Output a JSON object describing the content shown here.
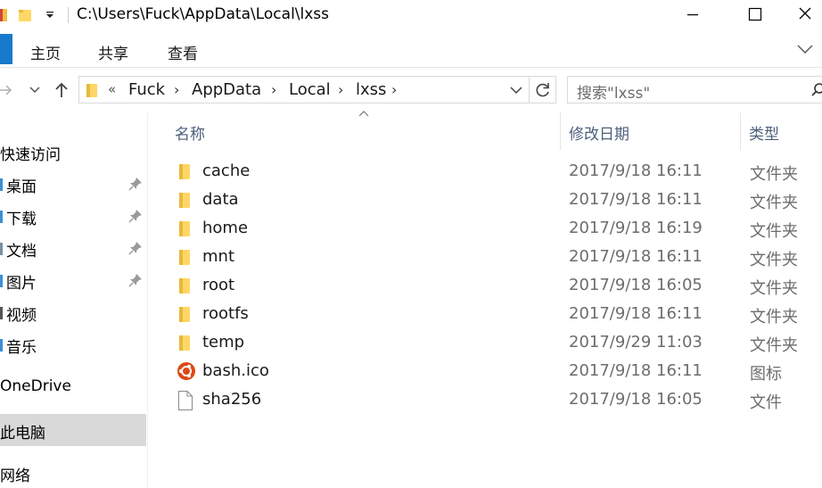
{
  "window": {
    "title": "C:\\Users\\Fuck\\AppData\\Local\\lxss"
  },
  "ribbon": {
    "tabs": [
      "主页",
      "共享",
      "查看"
    ]
  },
  "address": {
    "overflow": "«",
    "crumbs": [
      "Fuck",
      "AppData",
      "Local",
      "lxss"
    ],
    "separator": "›"
  },
  "search": {
    "placeholder": "搜索\"lxss\""
  },
  "sidebar": {
    "items": [
      {
        "label": "快速访问",
        "pinned": false
      },
      {
        "label": "桌面",
        "pinned": true
      },
      {
        "label": "下载",
        "pinned": true
      },
      {
        "label": "文档",
        "pinned": true
      },
      {
        "label": "图片",
        "pinned": true
      },
      {
        "label": "视频",
        "pinned": false
      },
      {
        "label": "音乐",
        "pinned": false
      },
      {
        "label": "OneDrive",
        "pinned": false
      },
      {
        "label": "此电脑",
        "pinned": false,
        "selected": true
      },
      {
        "label": "网络",
        "pinned": false
      }
    ]
  },
  "columns": {
    "name": "名称",
    "modified": "修改日期",
    "type": "类型"
  },
  "files": [
    {
      "name": "cache",
      "modified": "2017/9/18 16:11",
      "type": "文件夹",
      "icon": "folder-icon"
    },
    {
      "name": "data",
      "modified": "2017/9/18 16:11",
      "type": "文件夹",
      "icon": "folder-icon"
    },
    {
      "name": "home",
      "modified": "2017/9/18 16:19",
      "type": "文件夹",
      "icon": "folder-icon"
    },
    {
      "name": "mnt",
      "modified": "2017/9/18 16:11",
      "type": "文件夹",
      "icon": "folder-icon"
    },
    {
      "name": "root",
      "modified": "2017/9/18 16:05",
      "type": "文件夹",
      "icon": "folder-icon"
    },
    {
      "name": "rootfs",
      "modified": "2017/9/18 16:11",
      "type": "文件夹",
      "icon": "folder-icon"
    },
    {
      "name": "temp",
      "modified": "2017/9/29 11:03",
      "type": "文件夹",
      "icon": "folder-icon"
    },
    {
      "name": "bash.ico",
      "modified": "2017/9/18 16:11",
      "type": "图标",
      "icon": "ubuntu-icon"
    },
    {
      "name": "sha256",
      "modified": "2017/9/18 16:05",
      "type": "文件",
      "icon": "file-icon"
    }
  ],
  "colors": {
    "folder": "#ffd766",
    "ubuntu": "#dd4814",
    "accent": "#1979ca",
    "header_text": "#4c607a",
    "secondary_text": "#6d6d6d",
    "selected_bg": "#d9d9d9"
  }
}
